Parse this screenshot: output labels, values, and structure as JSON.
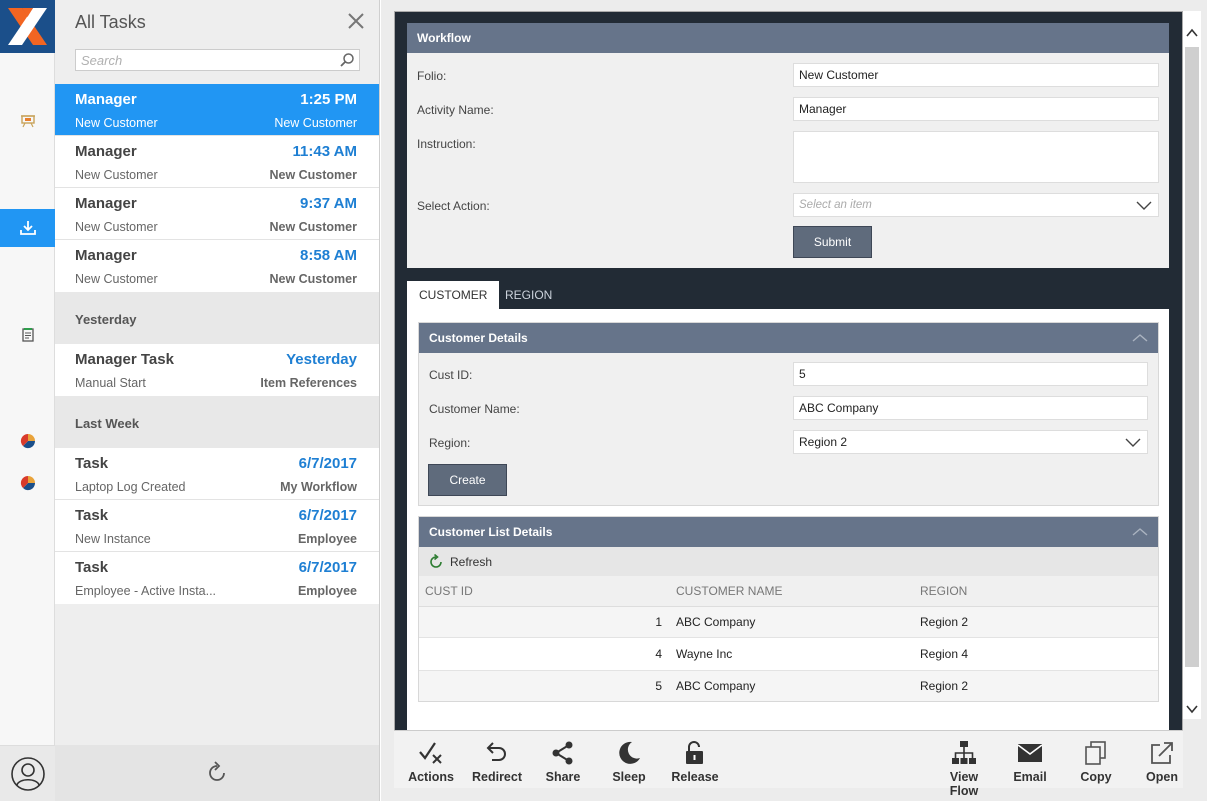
{
  "colors": {
    "accent": "#2196f3",
    "panel_header": "#66748a",
    "dark_bg": "#222b35",
    "brand_orange": "#f26522"
  },
  "task_panel": {
    "title": "All Tasks",
    "search_placeholder": "Search",
    "items": [
      {
        "name": "Manager",
        "time": "1:25 PM",
        "folio": "New Customer",
        "workflow": "New Customer",
        "selected": true
      },
      {
        "name": "Manager",
        "time": "11:43 AM",
        "folio": "New Customer",
        "workflow": "New Customer"
      },
      {
        "name": "Manager",
        "time": "9:37 AM",
        "folio": "New Customer",
        "workflow": "New Customer"
      },
      {
        "name": "Manager",
        "time": "8:58 AM",
        "folio": "New Customer",
        "workflow": "New Customer"
      }
    ],
    "groups": [
      {
        "label": "Yesterday",
        "items": [
          {
            "name": "Manager Task",
            "time": "Yesterday",
            "folio": "Manual Start",
            "workflow": "Item References"
          }
        ]
      },
      {
        "label": "Last Week",
        "items": [
          {
            "name": "Task",
            "time": "6/7/2017",
            "folio": "Laptop Log Created",
            "workflow": "My Workflow"
          },
          {
            "name": "Task",
            "time": "6/7/2017",
            "folio": "New Instance",
            "workflow": "Employee"
          },
          {
            "name": "Task",
            "time": "6/7/2017",
            "folio": "Employee - Active Insta...",
            "workflow": "Employee"
          }
        ]
      }
    ]
  },
  "workflow": {
    "header": "Workflow",
    "folio_label": "Folio:",
    "folio_value": "New Customer",
    "activity_label": "Activity Name:",
    "activity_value": "Manager",
    "instruction_label": "Instruction:",
    "instruction_value": "",
    "action_label": "Select Action:",
    "action_placeholder": "Select an item",
    "submit_label": "Submit"
  },
  "tabs": [
    {
      "label": "CUSTOMER",
      "active": true
    },
    {
      "label": "REGION",
      "active": false
    }
  ],
  "customer_details": {
    "header": "Customer Details",
    "cust_id_label": "Cust ID:",
    "cust_id_value": "5",
    "name_label": "Customer Name:",
    "name_value": "ABC Company",
    "region_label": "Region:",
    "region_value": "Region 2",
    "create_label": "Create"
  },
  "customer_list": {
    "header": "Customer List Details",
    "refresh_label": "Refresh",
    "columns": [
      "CUST ID",
      "CUSTOMER NAME",
      "REGION"
    ],
    "rows": [
      {
        "id": "1",
        "name": "ABC Company",
        "region": "Region 2"
      },
      {
        "id": "4",
        "name": "Wayne Inc",
        "region": "Region 4"
      },
      {
        "id": "5",
        "name": "ABC Company",
        "region": "Region 2"
      }
    ]
  },
  "toolbar": {
    "left": [
      {
        "label": "Actions",
        "icon": "actions-icon"
      },
      {
        "label": "Redirect",
        "icon": "redirect-icon"
      },
      {
        "label": "Share",
        "icon": "share-icon"
      },
      {
        "label": "Sleep",
        "icon": "sleep-icon"
      },
      {
        "label": "Release",
        "icon": "release-icon"
      }
    ],
    "right": [
      {
        "label": "View Flow",
        "icon": "view-flow-icon"
      },
      {
        "label": "Email",
        "icon": "email-icon"
      },
      {
        "label": "Copy",
        "icon": "copy-icon"
      },
      {
        "label": "Open",
        "icon": "open-icon"
      }
    ]
  }
}
